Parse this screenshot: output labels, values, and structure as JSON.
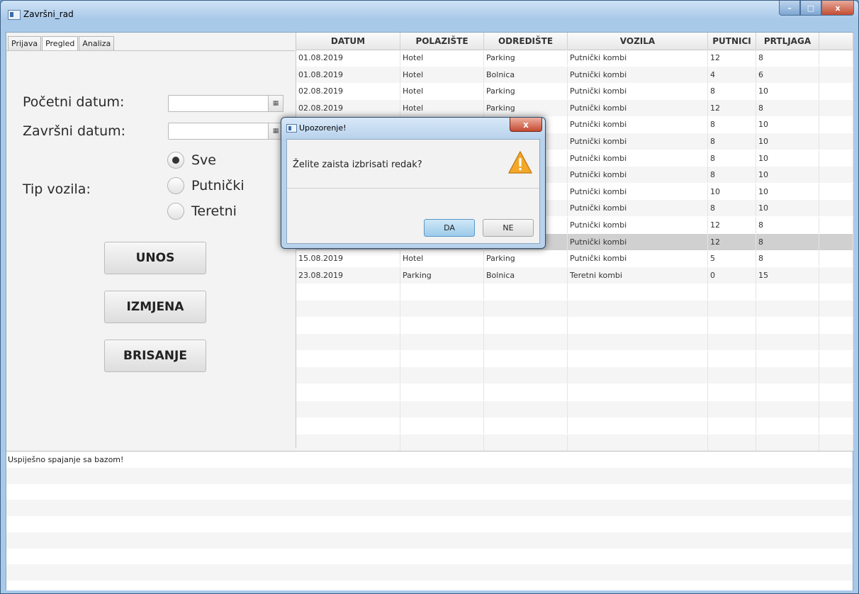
{
  "window": {
    "title": "Završni_rad",
    "buttons": [
      "–",
      "□",
      "x"
    ]
  },
  "tabs": [
    {
      "label": "Prijava",
      "active": false
    },
    {
      "label": "Pregled",
      "active": true
    },
    {
      "label": "Analiza",
      "active": false
    }
  ],
  "form": {
    "start_date_label": "Početni datum:",
    "start_date_value": "",
    "end_date_label": "Završni datum:",
    "end_date_value": "",
    "vehicle_type_label": "Tip vozila:",
    "radio_options": [
      {
        "label": "Sve",
        "selected": true
      },
      {
        "label": "Putnički",
        "selected": false
      },
      {
        "label": "Teretni",
        "selected": false
      }
    ],
    "buttons": {
      "add": "UNOS",
      "edit": "IZMJENA",
      "delete": "BRISANJE"
    }
  },
  "table": {
    "columns": [
      "DATUM",
      "POLAZIŠTE",
      "ODREDIŠTE",
      "VOZILA",
      "PUTNICI",
      "PRTLJAGA"
    ],
    "rows": [
      [
        "01.08.2019",
        "Hotel",
        "Parking",
        "Putnički kombi",
        "12",
        "8"
      ],
      [
        "01.08.2019",
        "Hotel",
        "Bolnica",
        "Putnički kombi",
        "4",
        "6"
      ],
      [
        "02.08.2019",
        "Hotel",
        "Parking",
        "Putnički kombi",
        "8",
        "10"
      ],
      [
        "02.08.2019",
        "Hotel",
        "Parking",
        "Putnički kombi",
        "12",
        "8"
      ],
      [
        "",
        "",
        "",
        "Putnički kombi",
        "8",
        "10"
      ],
      [
        "",
        "",
        "",
        "Putnički kombi",
        "8",
        "10"
      ],
      [
        "",
        "",
        "",
        "Putnički kombi",
        "8",
        "10"
      ],
      [
        "",
        "",
        "",
        "Putnički kombi",
        "8",
        "10"
      ],
      [
        "",
        "",
        "",
        "Putnički kombi",
        "10",
        "10"
      ],
      [
        "",
        "",
        "",
        "Putnički kombi",
        "8",
        "10"
      ],
      [
        "",
        "",
        "",
        "Putnički kombi",
        "12",
        "8"
      ],
      [
        "",
        "",
        "",
        "Putnički kombi",
        "12",
        "8"
      ],
      [
        "15.08.2019",
        "Hotel",
        "Parking",
        "Putnički kombi",
        "5",
        "8"
      ],
      [
        "23.08.2019",
        "Parking",
        "Bolnica",
        "Teretni kombi",
        "0",
        "15"
      ]
    ],
    "selected_row": 11
  },
  "log": {
    "lines": [
      "Uspiješno spajanje sa bazom!"
    ]
  },
  "dialog": {
    "title": "Upozorenje!",
    "message": "Želite zaista izbrisati redak?",
    "yes_label": "DA",
    "no_label": "NE",
    "icon": "warning-icon"
  },
  "colors": {
    "selected_row": "#d0d0d0",
    "warning": "#f0a020",
    "default_button": "#9ccbea"
  }
}
